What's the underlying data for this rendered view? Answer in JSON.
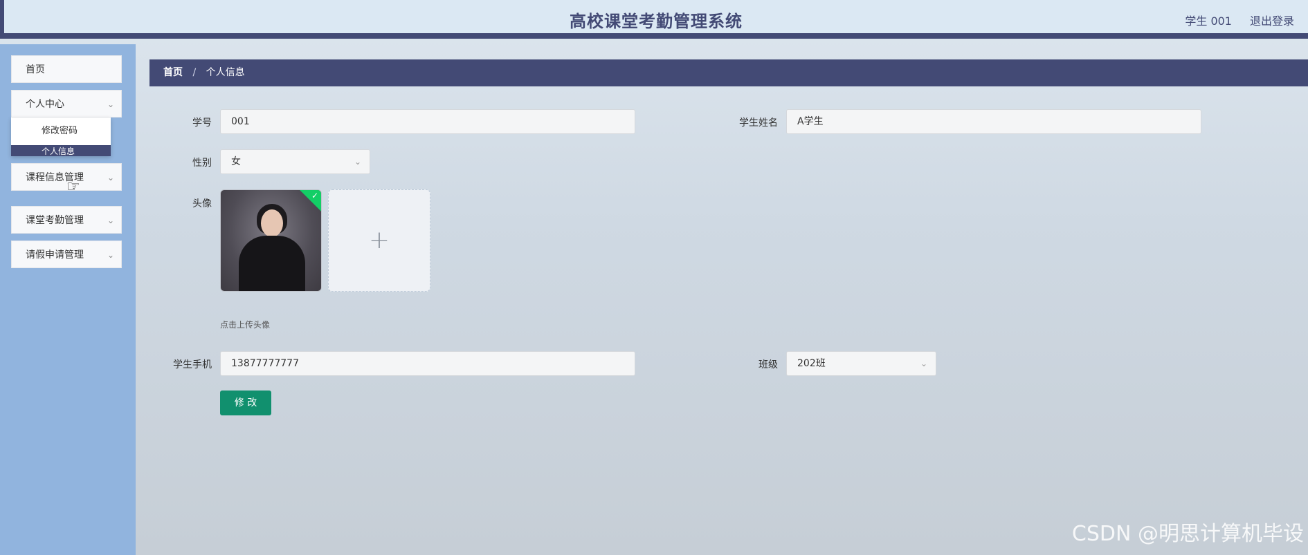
{
  "header": {
    "title": "高校课堂考勤管理系统",
    "user": "学生 001",
    "logout": "退出登录"
  },
  "sidebar": {
    "items": [
      {
        "label": "首页"
      },
      {
        "label": "个人中心"
      },
      {
        "label": "课程信息管理"
      },
      {
        "label": "课堂考勤管理"
      },
      {
        "label": "请假申请管理"
      }
    ],
    "submenu": {
      "item": "修改密码",
      "active_partial": "个人信息"
    }
  },
  "breadcrumb": {
    "home": "首页",
    "separator": "/",
    "current": "个人信息"
  },
  "form": {
    "student_no_label": "学号",
    "student_no_value": "001",
    "student_name_label": "学生姓名",
    "student_name_value": "A学生",
    "gender_label": "性别",
    "gender_value": "女",
    "avatar_label": "头像",
    "upload_hint": "点击上传头像",
    "phone_label": "学生手机",
    "phone_value": "13877777777",
    "class_label": "班级",
    "class_value": "202班",
    "submit_label": "修 改"
  },
  "watermark": "CSDN @明思计算机毕设",
  "colors": {
    "primary": "#434a75",
    "sidebar": "#91b4de",
    "submit": "#11906e",
    "success_badge": "#13ce66"
  }
}
